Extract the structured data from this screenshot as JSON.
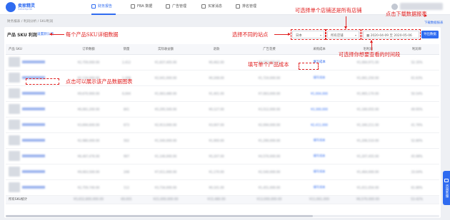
{
  "app": {
    "logo_title": "卖家精灵",
    "logo_subtitle": "SellerSprite"
  },
  "nav": [
    {
      "label": "财务报告",
      "active": true
    },
    {
      "label": "FBA 数据",
      "active": false
    },
    {
      "label": "广告管理",
      "active": false
    },
    {
      "label": "买家消息",
      "active": false
    },
    {
      "label": "排名管理",
      "active": false
    }
  ],
  "breadcrumb": "财务报表 / 利润分析 / SKU利润",
  "page": {
    "title": "产品 SKU 利润",
    "title_link": "设置默认项"
  },
  "controls": {
    "site_value": "日本",
    "store_value": "所有店铺",
    "date_start": "2020-04-09",
    "date_end": "2020-05-06",
    "date_separator": "至",
    "filter_button": "导出数据",
    "download_link": "下载数据报表"
  },
  "annotations": {
    "store": "可选择单个店铺还是所有店铺",
    "download": "点击下载数据报表",
    "sku_detail": "每个产品SKU详细数据",
    "site": "选择不同的站点",
    "date": "可选择你想要查看的时间段",
    "cost": "填写单个产品成本",
    "chart": "点击可以展示该产品数据图表"
  },
  "table": {
    "columns": [
      "产品 SKU",
      "订单数额",
      "销量",
      "实际收益额",
      "退款",
      "广告花费",
      "采购成本",
      "毛利润",
      "利润率"
    ],
    "rows": [
      {
        "orders": "¥2,759,000.00",
        "sales": "2,412",
        "revenue": "¥1,837,405.00",
        "refund": "¥0,462.00",
        "ad": "¥5,050,000.00",
        "cost_text": "填写成本",
        "profit": "¥1,064,971.00",
        "margin": "52.35%"
      },
      {
        "orders": "¥2,116,000.00",
        "sales": "1,208",
        "revenue": "¥2,041,000.00",
        "refund": "¥0,208.00",
        "ad": "¥1,724,000.00",
        "cost_text": "填写成本",
        "profit": "¥1,061,250.00",
        "margin": "61.63%"
      },
      {
        "orders": "¥9,670,900.00",
        "sales": "6,044",
        "revenue": "¥1,063,480.00",
        "refund": "¥1,401.00",
        "ad": "¥7,063,000.00",
        "cost_text": "¥1,004,000",
        "profit": "¥1,965,170.00",
        "margin": "50.54%"
      },
      {
        "orders": "¥6,061,200.00",
        "sales": "841",
        "revenue": "¥5,295,500.00",
        "refund": "¥0,127.00",
        "ad": "¥3,512,000.00",
        "cost_text": "¥3,300,000",
        "profit": "¥1,160,055.00",
        "margin": "49.95%"
      },
      {
        "orders": "¥3,694,600.00",
        "sales": "673",
        "revenue": "¥2,913,000.00",
        "refund": "¥3,007.00",
        "ad": "¥2,094,000.00",
        "cost_text": "¥2,411,000",
        "profit": "¥1,340,211.00",
        "margin": "41.76%"
      },
      {
        "orders": "¥2,980,000.00",
        "sales": "502",
        "revenue": "¥1,540,000.00",
        "refund": "¥1,900.00",
        "ad": "¥1,290,000.00",
        "cost_text": "填写成本",
        "profit": "¥1,206,510.00",
        "margin": "52.80%"
      },
      {
        "orders": "¥6,467,476.00",
        "sales": "997",
        "revenue": "¥1,146,000.00",
        "refund": "¥5,207.00",
        "ad": "¥4,570,000.00",
        "cost_text": "填写成本",
        "profit": "¥1,207,455.00",
        "margin": "45.98%"
      },
      {
        "orders": "¥9,063,500.00",
        "sales": "248",
        "revenue": "¥7,011,000.00",
        "refund": "¥1,170.00",
        "ad": "¥2,540,000.00",
        "cost_text": "填写成本",
        "profit": "¥1,464,000.00",
        "margin": "33.04%"
      },
      {
        "orders": "¥2,759,740.00",
        "sales": "112",
        "revenue": "¥3,734,000.00",
        "refund": "¥0,101.00",
        "ad": "¥1,451,000.00",
        "cost_text": "填写成本",
        "profit": "¥1,011,054.00",
        "margin": "61.86%"
      }
    ],
    "total": {
      "label": "所有SKU统计",
      "orders": "¥5,652,800,000.00",
      "sales": "60,001",
      "revenue": "¥21,000,000.00",
      "refund": "¥15,480.00",
      "ad": "¥13,000,000.00",
      "cost_text": "¥11,061,000",
      "profit": "¥6,570,000.00",
      "margin": "53.42%"
    }
  },
  "side_help": "咨询客服",
  "colors": {
    "accent": "#2f6bf0",
    "annotation": "#e12020"
  }
}
